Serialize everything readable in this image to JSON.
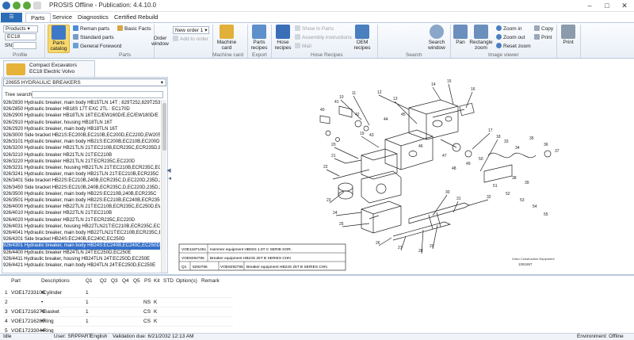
{
  "window": {
    "title": "PROSIS Offline - Publication: 4.4.10.0",
    "minimize": "–",
    "maximize": "□",
    "close": "✕"
  },
  "ribbon_tabs": [
    "Parts",
    "Service",
    "Diagnostics",
    "Certified Rebuild"
  ],
  "ribbon": {
    "products_label": "Products",
    "model": "EC18",
    "sn_label": "SN:",
    "profile_group": "Profile",
    "parts_catalog": "Parts catalog",
    "reman_parts": "Reman parts",
    "standard_parts": "Standard parts",
    "general_foreword": "General Foreword",
    "basic_facts": "Basic Facts",
    "parts_group": "Parts",
    "order_value": "New order 1",
    "add_to_order": "Add to order",
    "order_window": "Order window",
    "machine_card": "Machine card",
    "machine_card_group": "Machine card",
    "parts_recipes": "Parts recipes",
    "export_group": "Export",
    "hose_recipes": "Hose recipes",
    "show_in_parts": "Show in Parts",
    "assembly_instructions": "Assembly instructions",
    "mail": "Mail",
    "oem_recipes": "OEM recipes",
    "hose_recipes_group": "Hose Recipes",
    "search_window": "Search window",
    "search_group": "Search",
    "pan": "Pan",
    "rectangle_zoom": "Rectangle zoom",
    "zoom_in": "Zoom in",
    "zoom_out": "Zoom out",
    "reset_zoom": "Reset zoom",
    "copy": "Copy",
    "print_small": "Print",
    "image_viewer_group": "Image viewer",
    "print": "Print"
  },
  "doc_tab": {
    "line1": "Compact Excavators",
    "line2": "EC18 Electric Volvo"
  },
  "left_pane": {
    "group_select": "20655 HYDRAULIC BREAKERS",
    "tree_search_label": "Tree search:",
    "items": [
      "926/2830 Hydraulic breaker, main body HB15TLN 14T ; 829T252,829T253,8",
      "926/2850 Hydraulic breaker HB18S 17T EXC 2TL : EC170D",
      "926/2900 Hydraulic breaker HB18TLN 16T:EC/EW160D/E,EC/EW180D/E",
      "926/2910 Hydraulic breaker, housing HB18TLN 16T",
      "926/2920 Hydraulic breaker, main body HB18TLN 16T",
      "926/3000 Side bracket HB21S:EC200B,EC210B,EC200D,EC220D,EW205D",
      "926/3101 Hydraulic breaker, main body HB21S:EC200B,EC210B,EC200D,EC",
      "926/3200 Hydraulic breaker HB21TLN 21T:EC210B,ECR235C,ECR235D,E",
      "926/3210 Hydraulic breaker HB21TLN 21T:EC210B",
      "926/3220 Hydraulic breaker HB21TLN 21T:ECR235C,EC220D",
      "926/3231 Hydraulic breaker, housing HB21TLN 21T:EC210B,ECR235C,EC",
      "926/3241 Hydraulic breaker, main body HB21TLN 21T:EC210B,ECR235C",
      "926/3401 Side bracket HB22S:EC210B,240B,ECR235C,D,EC220D,235D,25",
      "926/3450 Side bracket HB22S:EC210B,240B,ECR235C,D,EC220D,235D,25",
      "926/3500 Hydraulic breaker, main body HB22S:EC210B,240B,ECR235C",
      "926/3501 Hydraulic breaker, main body HB22S:EC210B,EC240B,ECR235C",
      "926/4000 Hydraulic breaker HB22TLN 21T:EC210B,ECR235C,EC250D,EW2",
      "926/4010 Hydraulic breaker HB22TLN 21T:EC210B",
      "926/4020 Hydraulic breaker HB22TLN 21T:ECR235C,EC220D",
      "926/4031 Hydraulic breaker, housing HB22TLN21T:EC210B,ECR235C,EC2",
      "926/4041 Hydraulic breaker, main body HB22TLN21T:EC210B,ECR235C,EC",
      "926/4201 Side bracket HB24S:EC240B,EC240C,EC250D",
      "926/4301 Hydraulic breaker, main body HB24S:EC240B,EC240C,EC250D",
      "926/4400 Hydraulic breaker HB24TLN 24T:EC250D,EC250E",
      "926/4411 Hydraulic breaker, housing HB24TLN 24T:EC250D,EC250E",
      "926/4421 Hydraulic breaker, main body HB24TLN 24T:EC250D,EC250E"
    ],
    "selected_index": 22
  },
  "drawing": {
    "table_rows": [
      [
        "",
        "VOE11871451",
        "Hammer equipment HB02S 1.5T C SERIE KOR."
      ],
      [
        "",
        "VOE8292765",
        "Breaker equipment HB24S 25T B SERIES CHN"
      ],
      [
        "Q1",
        "8292765",
        "VOE8292765",
        "Breaker equipment HB24S 25T B SERIES CHN"
      ]
    ],
    "stamp": "Volvo Construction Equipment",
    "stamp_id": "1081867",
    "callouts": [
      "10",
      "11",
      "12",
      "13",
      "14",
      "15",
      "16",
      "17",
      "18",
      "19",
      "20",
      "21",
      "22",
      "23",
      "24",
      "25",
      "26",
      "27",
      "28",
      "29",
      "30",
      "31",
      "32",
      "33",
      "34",
      "35",
      "36",
      "37",
      "38",
      "39",
      "40",
      "41",
      "42",
      "43",
      "44",
      "45",
      "46",
      "47",
      "48",
      "49",
      "50",
      "51",
      "52",
      "53",
      "54",
      "55"
    ]
  },
  "parts_table": {
    "headers": [
      "Part",
      "Descriptions",
      "Q1",
      "Q2",
      "Q3",
      "Q4",
      "Q5",
      "PS",
      "Kit",
      "STD",
      "Option(s)",
      "Remark"
    ],
    "rows": [
      {
        "idx": "1",
        "part": "VOE17233108",
        "desc": "•Cylinder",
        "q1": "1",
        "ps": "",
        "kit": ""
      },
      {
        "idx": "2",
        "part": "",
        "desc": "•",
        "q1": "1",
        "ps": "NS",
        "kit": "K"
      },
      {
        "idx": "3",
        "part": "VOE17216279",
        "desc": "•Gasket",
        "q1": "1",
        "ps": "CS",
        "kit": "K"
      },
      {
        "idx": "4",
        "part": "VOE17216280",
        "desc": "•Ring",
        "q1": "1",
        "ps": "CS",
        "kit": "K"
      },
      {
        "idx": "5",
        "part": "VOE17233044",
        "desc": "•Ring",
        "q1": "",
        "ps": "",
        "kit": ""
      }
    ]
  },
  "status": {
    "state": "Idle",
    "user": "User: SRPPART",
    "language": "English",
    "validation": "Validation due: 6/21/2032 12:13 AM",
    "environment": "Environment: Offline"
  },
  "colors": {
    "accent": "#2b6cb6",
    "selection": "#3670c9",
    "ribbon_border": "#b9c9dc"
  }
}
